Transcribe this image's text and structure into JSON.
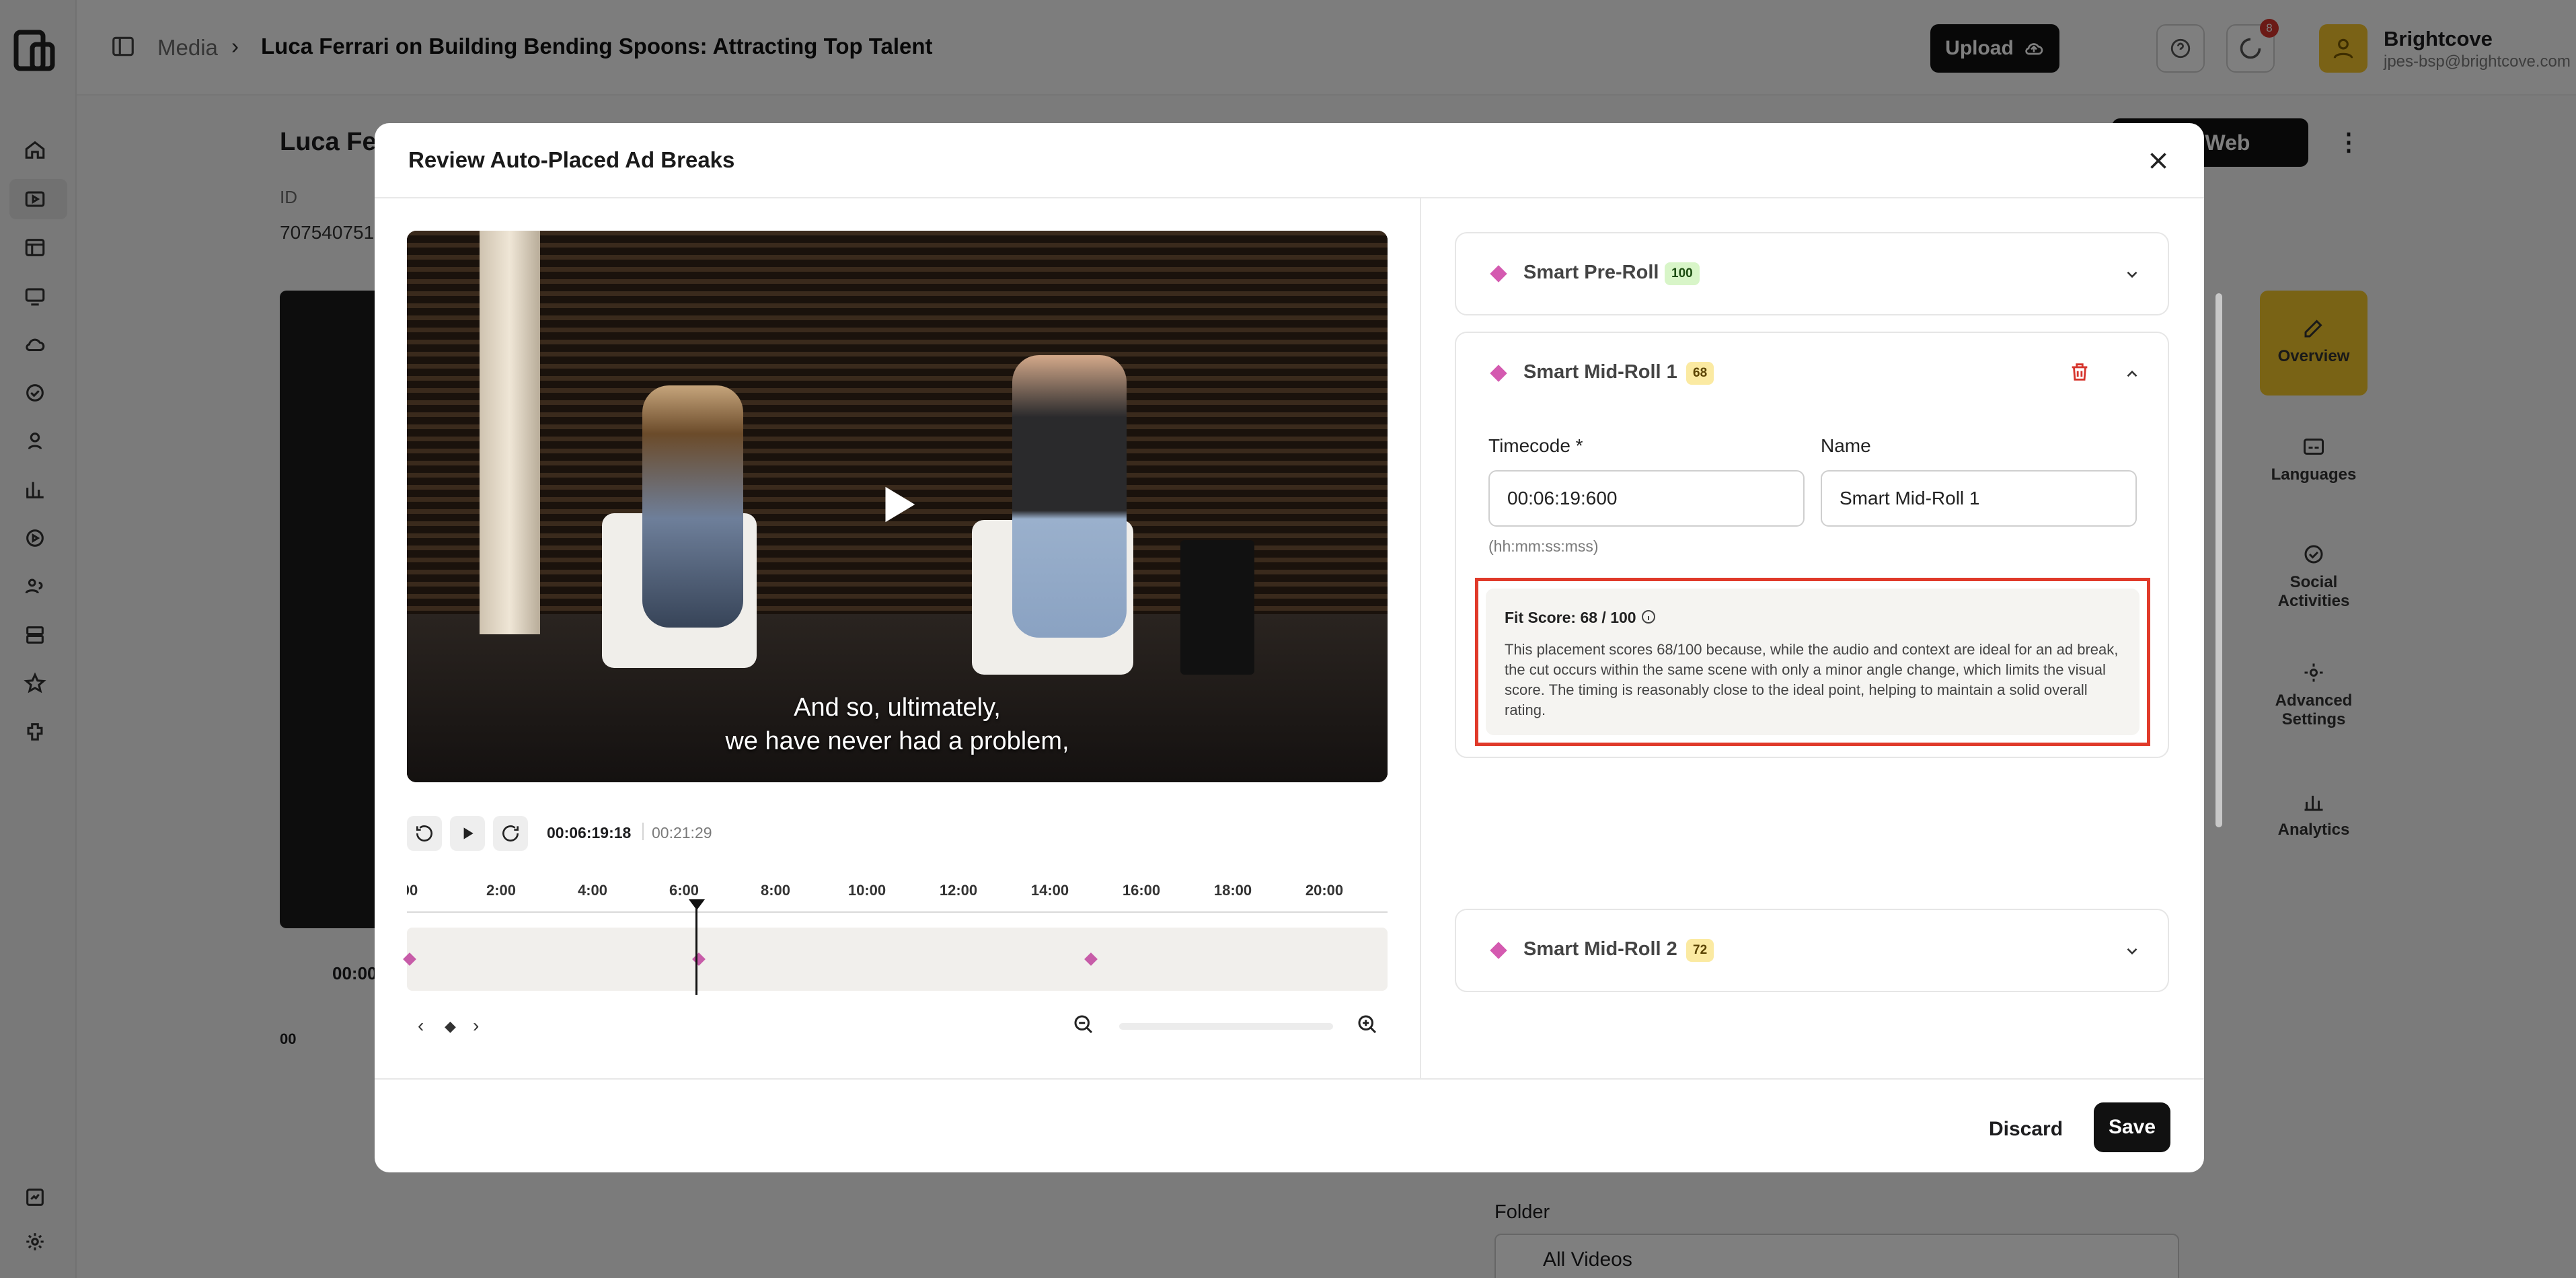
{
  "header": {
    "breadcrumb_root": "Media",
    "breadcrumb_sep": "›",
    "breadcrumb_current": "Luca Ferrari on Building Bending Spoons: Attracting Top Talent",
    "upload_label": "Upload",
    "notification_count": "8",
    "account_name": "Brightcove",
    "account_email": "jpes-bsp@brightcove.com"
  },
  "background_page": {
    "title": "Luca Fer",
    "id_label": "ID",
    "id_value": "707540751",
    "publish_label": "o Web",
    "time": "00:00",
    "ruler_start": "00",
    "folder_label": "Folder",
    "folder_value": "All Videos"
  },
  "right_nav": [
    {
      "label": "Overview"
    },
    {
      "label": "Languages"
    },
    {
      "label": "Social Activities"
    },
    {
      "label": "Advanced Settings"
    },
    {
      "label": "Analytics"
    }
  ],
  "modal": {
    "title": "Review Auto-Placed Ad Breaks",
    "discard_label": "Discard",
    "save_label": "Save"
  },
  "player": {
    "subtitle_line1": "And so, ultimately,",
    "subtitle_line2": "we have never had a problem,",
    "current_time": "00:06:19:18",
    "duration": "00:21:29",
    "playhead_fraction": 0.294
  },
  "timeline": {
    "ticks": [
      "00",
      "2:00",
      "4:00",
      "6:00",
      "8:00",
      "10:00",
      "12:00",
      "14:00",
      "16:00",
      "18:00",
      "20:00"
    ],
    "markers_minutes": [
      0,
      6.33,
      14.9
    ]
  },
  "ad_breaks": [
    {
      "name": "Smart Pre-Roll",
      "score": "100",
      "expanded": false
    },
    {
      "name": "Smart Mid-Roll 1",
      "score": "68",
      "expanded": true,
      "timecode_label": "Timecode *",
      "timecode_value": "00:06:19:600",
      "timecode_hint": "(hh:mm:ss:mss)",
      "name_label": "Name",
      "name_value": "Smart Mid-Roll 1",
      "fit_title": "Fit Score: 68 / 100",
      "fit_text": "This placement scores 68/100 because, while the audio and context are ideal for an ad break, the cut occurs within the same scene with only a minor angle change, which limits the visual score. The timing is reasonably close to the ideal point, helping to maintain a solid overall rating."
    },
    {
      "name": "Smart Mid-Roll 2",
      "score": "72",
      "expanded": false
    }
  ],
  "colors": {
    "accent_yellow": "#f2c62b",
    "marker_pink": "#d45ab0",
    "highlight_red": "#e03a2a"
  }
}
